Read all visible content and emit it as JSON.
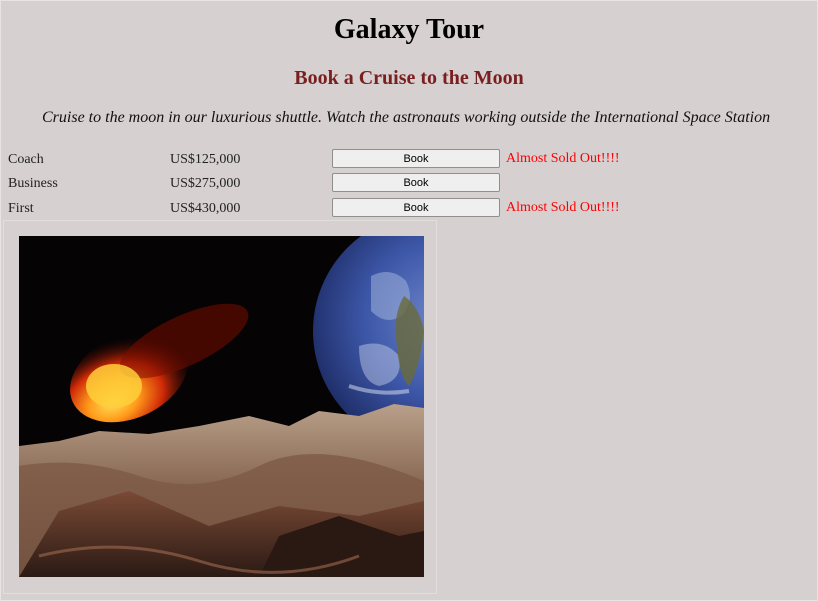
{
  "page": {
    "title": "Galaxy Tour",
    "subtitle": "Book a Cruise to the Moon",
    "description": "Cruise to the moon in our luxurious shuttle. Watch the astronauts working outside the International Space Station"
  },
  "tickets": [
    {
      "class": "Coach",
      "price": "US$125,000",
      "button": "Book",
      "status": "Almost Sold Out!!!!"
    },
    {
      "class": "Business",
      "price": "US$275,000",
      "button": "Book",
      "status": ""
    },
    {
      "class": "First",
      "price": "US$430,000",
      "button": "Book",
      "status": "Almost Sold Out!!!!"
    }
  ],
  "colors": {
    "background": "#d6d0d0",
    "subtitle": "#7a1f1f",
    "status": "#ff0000"
  },
  "image": {
    "icon": "moon-landscape-with-earth-and-meteor"
  }
}
